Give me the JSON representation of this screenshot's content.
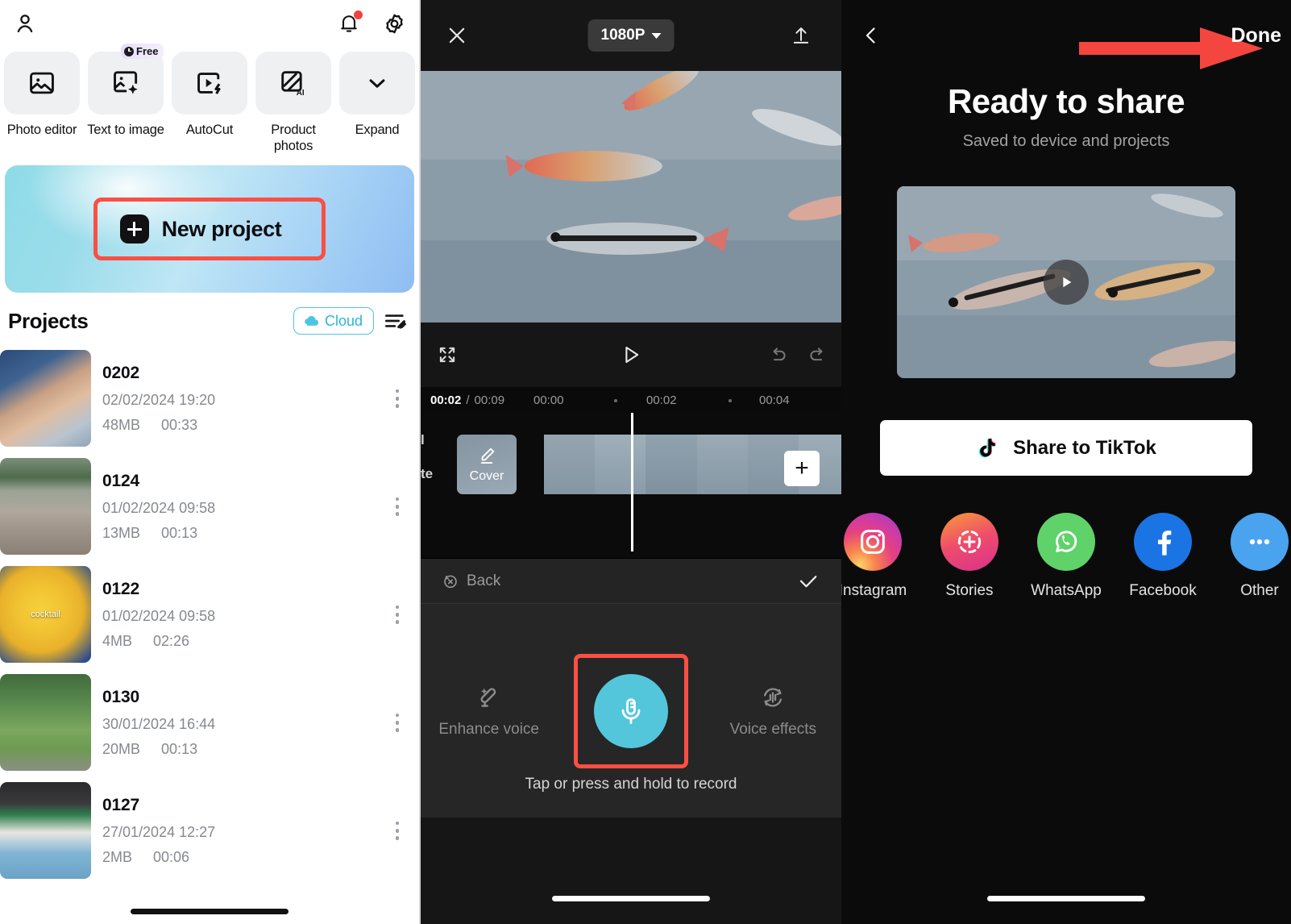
{
  "home": {
    "topbar": {
      "avatar": "profile-avatar",
      "bell": "notification-bell",
      "settings": "settings-gear"
    },
    "tools": [
      {
        "label": "Photo editor",
        "icon": "photo-editor-icon",
        "badge": null
      },
      {
        "label": "Text to image",
        "icon": "text-to-image-icon",
        "badge": "Free"
      },
      {
        "label": "AutoCut",
        "icon": "autocut-icon",
        "badge": null
      },
      {
        "label": "Product photos",
        "icon": "product-photos-ai-icon",
        "badge": null
      },
      {
        "label": "Expand",
        "icon": "chevron-down-icon",
        "badge": null
      }
    ],
    "new_project": {
      "label": "New project",
      "highlight_color": "#fb4f43"
    },
    "projects_header": {
      "title": "Projects",
      "cloud_label": "Cloud",
      "cloud_color": "#2ab8d6",
      "edit_icon": "list-edit-icon"
    },
    "projects": [
      {
        "name": "0202",
        "date": "02/02/2024 19:20",
        "size": "48MB",
        "duration": "00:33",
        "thumb_caption": ""
      },
      {
        "name": "0124",
        "date": "01/02/2024 09:58",
        "size": "13MB",
        "duration": "00:13",
        "thumb_caption": ""
      },
      {
        "name": "0122",
        "date": "01/02/2024 09:58",
        "size": "4MB",
        "duration": "02:26",
        "thumb_caption": "cocktail"
      },
      {
        "name": "0130",
        "date": "30/01/2024 16:44",
        "size": "20MB",
        "duration": "00:13",
        "thumb_caption": ""
      },
      {
        "name": "0127",
        "date": "27/01/2024 12:27",
        "size": "2MB",
        "duration": "00:06",
        "thumb_caption": ""
      }
    ]
  },
  "editor": {
    "topbar": {
      "close": "close-icon",
      "resolution": "1080P",
      "export": "export-upload-icon"
    },
    "controls": {
      "fullscreen": "fullscreen-icon",
      "play": "play-icon",
      "undo": "undo-icon",
      "redo": "redo-icon"
    },
    "ruler": {
      "current_time": "00:02",
      "separator": "/",
      "total_time": "00:09",
      "ticks": [
        "00:00",
        "00:02",
        "00:04"
      ]
    },
    "timeline": {
      "cover_label": "Cover",
      "left_partial_top": "l",
      "left_partial_bottom": "te",
      "add_button": "+"
    },
    "backbar": {
      "back_label": "Back",
      "confirm": "check-icon"
    },
    "voice_panel": {
      "left_label": "Enhance voice",
      "left_icon": "enhance-voice-icon",
      "right_label": "Voice effects",
      "right_icon": "voice-effects-icon",
      "record_icon": "microphone-icon",
      "record_color": "#53c6dc",
      "highlight_color": "#fb4f43",
      "hint": "Tap or press and hold to record"
    }
  },
  "share": {
    "topbar": {
      "back": "chevron-left-icon",
      "done_label": "Done"
    },
    "arrow": {
      "name": "red-pointer-arrow",
      "color": "#f5453f"
    },
    "title": "Ready to share",
    "subtitle": "Saved to device and projects",
    "video": {
      "play": "play-icon"
    },
    "tiktok_button": {
      "label": "Share to TikTok",
      "icon": "tiktok-icon"
    },
    "targets": [
      {
        "label": "Instagram",
        "icon": "instagram-icon"
      },
      {
        "label": "Stories",
        "icon": "stories-icon"
      },
      {
        "label": "WhatsApp",
        "icon": "whatsapp-icon"
      },
      {
        "label": "Facebook",
        "icon": "facebook-icon"
      },
      {
        "label": "Other",
        "icon": "more-dots-icon"
      }
    ]
  }
}
